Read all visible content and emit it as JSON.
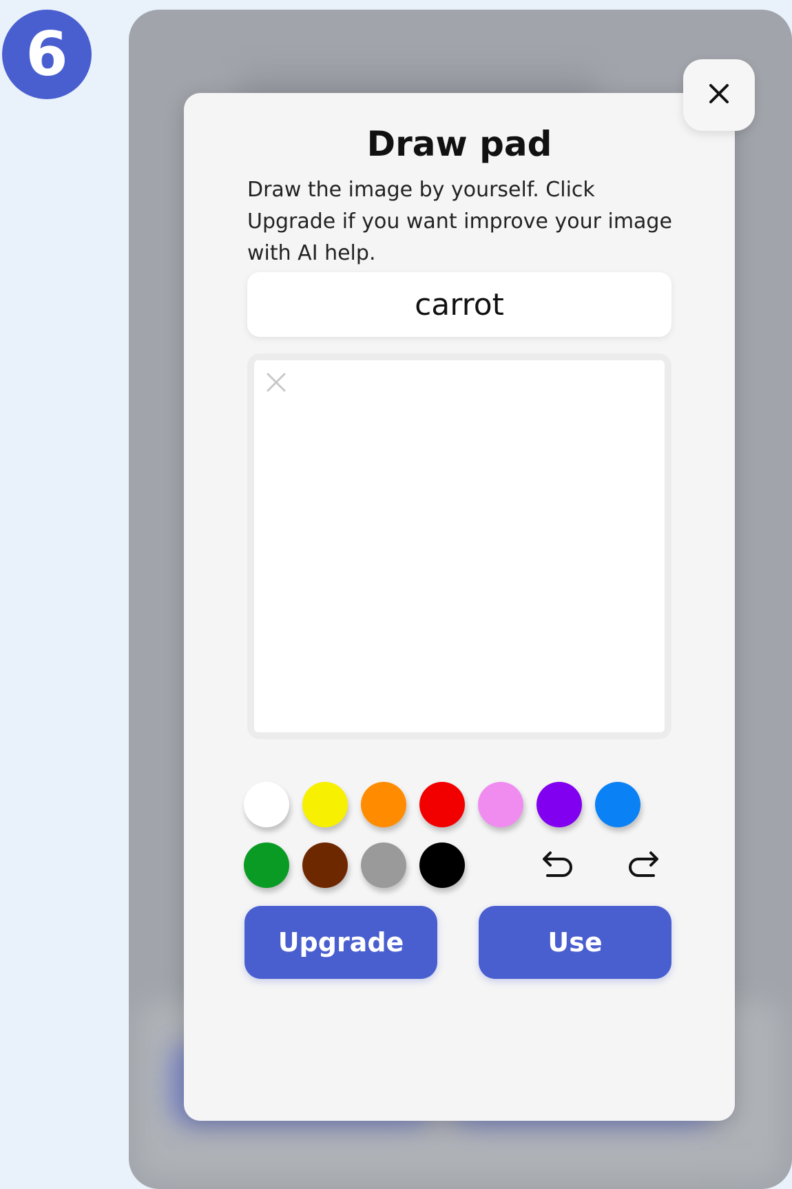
{
  "step_badge": "6",
  "modal": {
    "title": "Draw pad",
    "description": "Draw the image by yourself. Click Upgrade if you want improve your image with AI help.",
    "prompt_value": "carrot",
    "upgrade_label": "Upgrade",
    "use_label": "Use"
  },
  "icons": {
    "close": "close-icon",
    "clear_canvas": "clear-canvas-icon",
    "undo": "undo-icon",
    "redo": "redo-icon"
  },
  "palette": [
    {
      "name": "white",
      "color": "#ffffff"
    },
    {
      "name": "yellow",
      "color": "#f7f000"
    },
    {
      "name": "orange",
      "color": "#ff8c00"
    },
    {
      "name": "red",
      "color": "#f20000"
    },
    {
      "name": "pink",
      "color": "#f08cf0"
    },
    {
      "name": "purple",
      "color": "#8200f0"
    },
    {
      "name": "blue",
      "color": "#0a82f5"
    },
    {
      "name": "green",
      "color": "#0a9b25"
    },
    {
      "name": "brown",
      "color": "#6e2800"
    },
    {
      "name": "gray",
      "color": "#9a9a9a"
    },
    {
      "name": "black",
      "color": "#000000"
    }
  ],
  "colors": {
    "accent": "#4a5fcf",
    "background": "#e9f1fb",
    "overlay": "#a1a5ab",
    "modal": "#f5f5f5"
  }
}
